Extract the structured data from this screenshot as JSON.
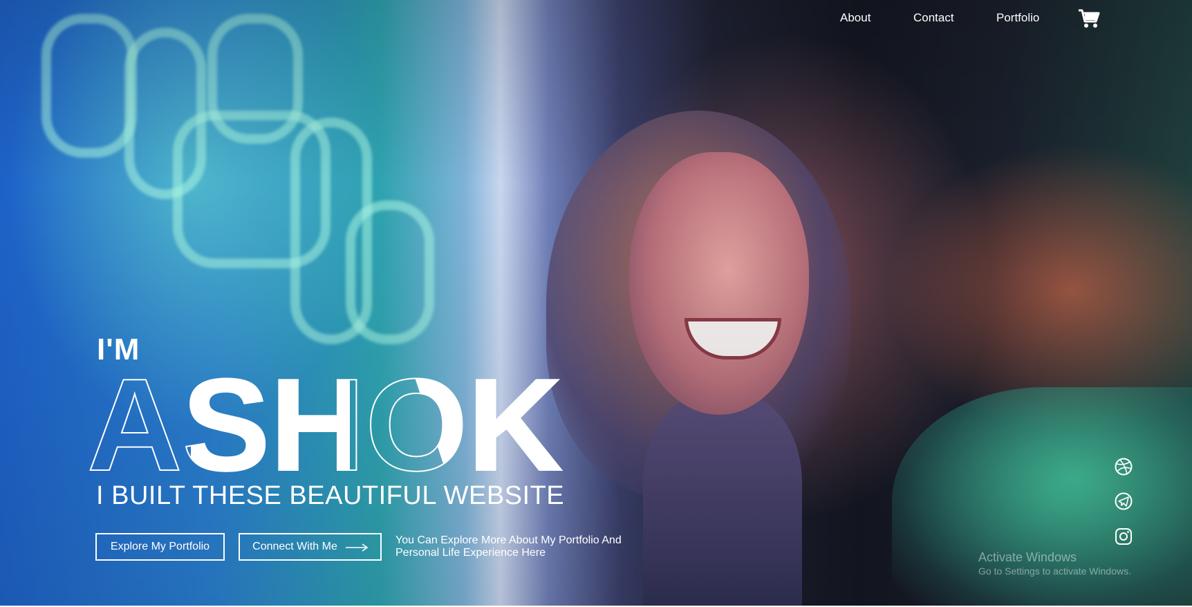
{
  "nav": {
    "about": "About",
    "contact": "Contact",
    "portfolio": "Portfolio",
    "cart_icon": "cart-icon"
  },
  "hero": {
    "intro": "I'M",
    "name": "ASHOK",
    "tagline": "I BUILT THESE BEAUTIFUL WEBSITE",
    "explore_button": "Explore My Portfolio",
    "connect_button": "Connect With Me",
    "connect_icon": "arrow-right-icon",
    "note": "You Can Explore More About My Portfolio And Personal Life Experience Here"
  },
  "social": [
    {
      "icon": "dribbble-icon"
    },
    {
      "icon": "telegram-icon"
    },
    {
      "icon": "instagram-icon"
    }
  ],
  "watermark": {
    "title": "Activate Windows",
    "subtitle": "Go to Settings to activate Windows."
  },
  "colors": {
    "text": "#ffffff",
    "accent_teal": "#2fa3b0",
    "accent_blue": "#1e62c8"
  }
}
